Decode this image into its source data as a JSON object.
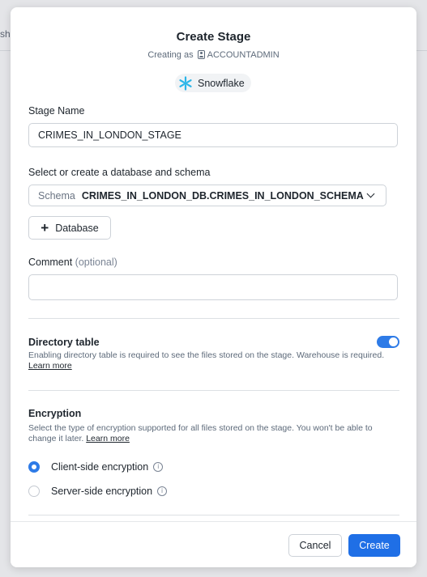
{
  "background": {
    "partial_tab_text": "sh"
  },
  "dialog": {
    "title": "Create Stage",
    "creating_as_label": "Creating as",
    "role": "ACCOUNTADMIN",
    "account": "Snowflake"
  },
  "stage_name": {
    "label": "Stage Name",
    "value": "CRIMES_IN_LONDON_STAGE"
  },
  "location": {
    "label": "Select or create a database and schema",
    "schema_prefix": "Schema",
    "schema_value": "CRIMES_IN_LONDON_DB.CRIMES_IN_LONDON_SCHEMA",
    "add_database_label": "Database"
  },
  "comment": {
    "label": "Comment",
    "optional": "(optional)",
    "value": ""
  },
  "directory_table": {
    "title": "Directory table",
    "description": "Enabling directory table is required to see the files stored on the stage. Warehouse is required.",
    "learn_more": "Learn more",
    "enabled": true
  },
  "encryption": {
    "title": "Encryption",
    "description": "Select the type of encryption supported for all files stored on the stage. You won't be able to change it later.",
    "learn_more": "Learn more",
    "options": [
      {
        "label": "Client-side encryption",
        "selected": true
      },
      {
        "label": "Server-side encryption",
        "selected": false
      }
    ]
  },
  "footer": {
    "cancel_label": "Cancel",
    "create_label": "Create"
  },
  "colors": {
    "accent": "#1f6fe6",
    "toggle": "#2e7be7"
  }
}
